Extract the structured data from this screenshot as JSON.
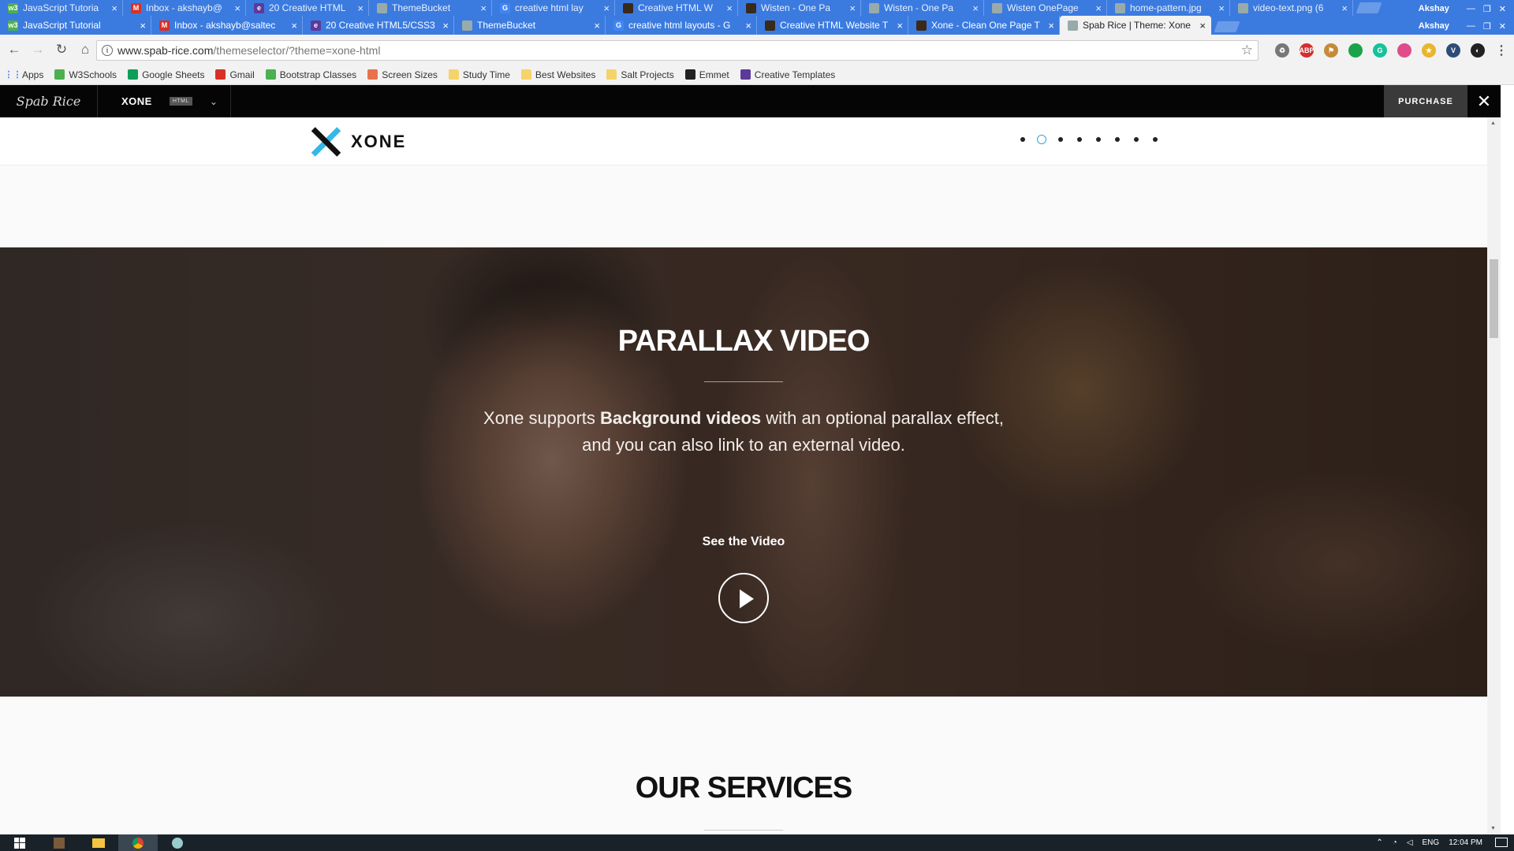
{
  "browser": {
    "back_tabs": [
      {
        "title": "JavaScript Tutoria",
        "fav": "w3-icon",
        "color": "#4caf50",
        "glyph": "w3"
      },
      {
        "title": "Inbox - akshayb@",
        "fav": "gmail-icon",
        "color": "#d93025",
        "glyph": "M"
      },
      {
        "title": "20 Creative HTML",
        "fav": "envato-icon",
        "color": "#5c3a9a",
        "glyph": "e"
      },
      {
        "title": "ThemeBucket",
        "fav": "page-icon",
        "color": "#9aa",
        "glyph": ""
      },
      {
        "title": "creative html lay",
        "fav": "google-icon",
        "color": "#4285f4",
        "glyph": "G"
      },
      {
        "title": "Creative HTML W",
        "fav": "site-icon",
        "color": "#3a2a1a",
        "glyph": ""
      },
      {
        "title": "Wisten - One Pa",
        "fav": "site-icon",
        "color": "#3a2a1a",
        "glyph": ""
      },
      {
        "title": "Wisten - One Pa",
        "fav": "page-icon",
        "color": "#9aa",
        "glyph": ""
      },
      {
        "title": "Wisten OnePage",
        "fav": "page-icon",
        "color": "#9aa",
        "glyph": ""
      },
      {
        "title": "home-pattern.jpg",
        "fav": "page-icon",
        "color": "#9aa",
        "glyph": ""
      },
      {
        "title": "video-text.png (6",
        "fav": "page-icon",
        "color": "#9aa",
        "glyph": ""
      }
    ],
    "front_tabs": [
      {
        "title": "JavaScript Tutorial",
        "fav": "w3-icon",
        "color": "#4caf50",
        "glyph": "w3"
      },
      {
        "title": "Inbox - akshayb@saltec",
        "fav": "gmail-icon",
        "color": "#d93025",
        "glyph": "M"
      },
      {
        "title": "20 Creative HTML5/CSS3",
        "fav": "envato-icon",
        "color": "#5c3a9a",
        "glyph": "e"
      },
      {
        "title": "ThemeBucket",
        "fav": "page-icon",
        "color": "#9aa",
        "glyph": ""
      },
      {
        "title": "creative html layouts - G",
        "fav": "google-icon",
        "color": "#4285f4",
        "glyph": "G"
      },
      {
        "title": "Creative HTML Website T",
        "fav": "site-icon",
        "color": "#3a2a1a",
        "glyph": ""
      },
      {
        "title": "Xone - Clean One Page T",
        "fav": "site-icon",
        "color": "#3a2a1a",
        "glyph": ""
      },
      {
        "title": "Spab Rice | Theme: Xone",
        "fav": "page-icon",
        "color": "#9aa",
        "glyph": "",
        "active": true
      }
    ],
    "user_label_top": "Akshay",
    "user_label_bottom": "Akshay",
    "url_host": "www.spab-rice.com",
    "url_path": "/themeselector/?theme=xone-html",
    "extensions": [
      {
        "name": "recycle-ext-icon",
        "color": "#777",
        "glyph": "♻"
      },
      {
        "name": "adblock-plus-icon",
        "color": "#d32f2f",
        "glyph": "ABP"
      },
      {
        "name": "flag-ext-icon",
        "color": "#c58a3a",
        "glyph": "⚑"
      },
      {
        "name": "green-dot-ext-icon",
        "color": "#1aa34a",
        "glyph": ""
      },
      {
        "name": "grammarly-icon",
        "color": "#15c39a",
        "glyph": "G"
      },
      {
        "name": "color-ext-icon",
        "color": "#e04b8a",
        "glyph": ""
      },
      {
        "name": "star-ext-icon",
        "color": "#e8b62c",
        "glyph": "★"
      },
      {
        "name": "v-ext-icon",
        "color": "#2c4c7a",
        "glyph": "V"
      },
      {
        "name": "dark-ext-icon",
        "color": "#222",
        "glyph": "◐"
      }
    ]
  },
  "bookmarks": [
    {
      "label": "Apps",
      "icon": "apps-grid-icon",
      "color": "#4285f4",
      "type": "apps"
    },
    {
      "label": "W3Schools",
      "icon": "w3-icon",
      "color": "#4caf50",
      "type": "site"
    },
    {
      "label": "Google Sheets",
      "icon": "sheets-icon",
      "color": "#0f9d58",
      "type": "site"
    },
    {
      "label": "Gmail",
      "icon": "gmail-icon",
      "color": "#d93025",
      "type": "site"
    },
    {
      "label": "Bootstrap Classes",
      "icon": "w3-icon",
      "color": "#4caf50",
      "type": "site"
    },
    {
      "label": "Screen Sizes",
      "icon": "gear-icon",
      "color": "#e8734a",
      "type": "site"
    },
    {
      "label": "Study Time",
      "icon": "folder-icon",
      "color": "#f5d36b",
      "type": "folder"
    },
    {
      "label": "Best Websites",
      "icon": "folder-icon",
      "color": "#f5d36b",
      "type": "folder"
    },
    {
      "label": "Salt Projects",
      "icon": "folder-icon",
      "color": "#f5d36b",
      "type": "folder"
    },
    {
      "label": "Emmet",
      "icon": "emmet-icon",
      "color": "#222",
      "type": "site"
    },
    {
      "label": "Creative Templates",
      "icon": "envato-icon",
      "color": "#5c3a9a",
      "type": "site"
    }
  ],
  "selector": {
    "logo_text": "Spab Rice",
    "theme_name": "XONE",
    "badge": "HTML",
    "purchase_label": "PURCHASE"
  },
  "site": {
    "brand_name": "XONE",
    "accent": "#35b8e8",
    "section_dots_count": 8,
    "active_dot_index": 1
  },
  "video": {
    "title": "PARALLAX VIDEO",
    "desc_prefix": "Xone supports ",
    "desc_bold": "Background videos",
    "desc_suffix": " with an optional parallax effect,",
    "desc_line2": "and you can also link to an external video.",
    "cta": "See the Video"
  },
  "services": {
    "title": "OUR SERVICES"
  },
  "taskbar": {
    "tray_lang": "ENG",
    "clock": "12:04 PM"
  }
}
